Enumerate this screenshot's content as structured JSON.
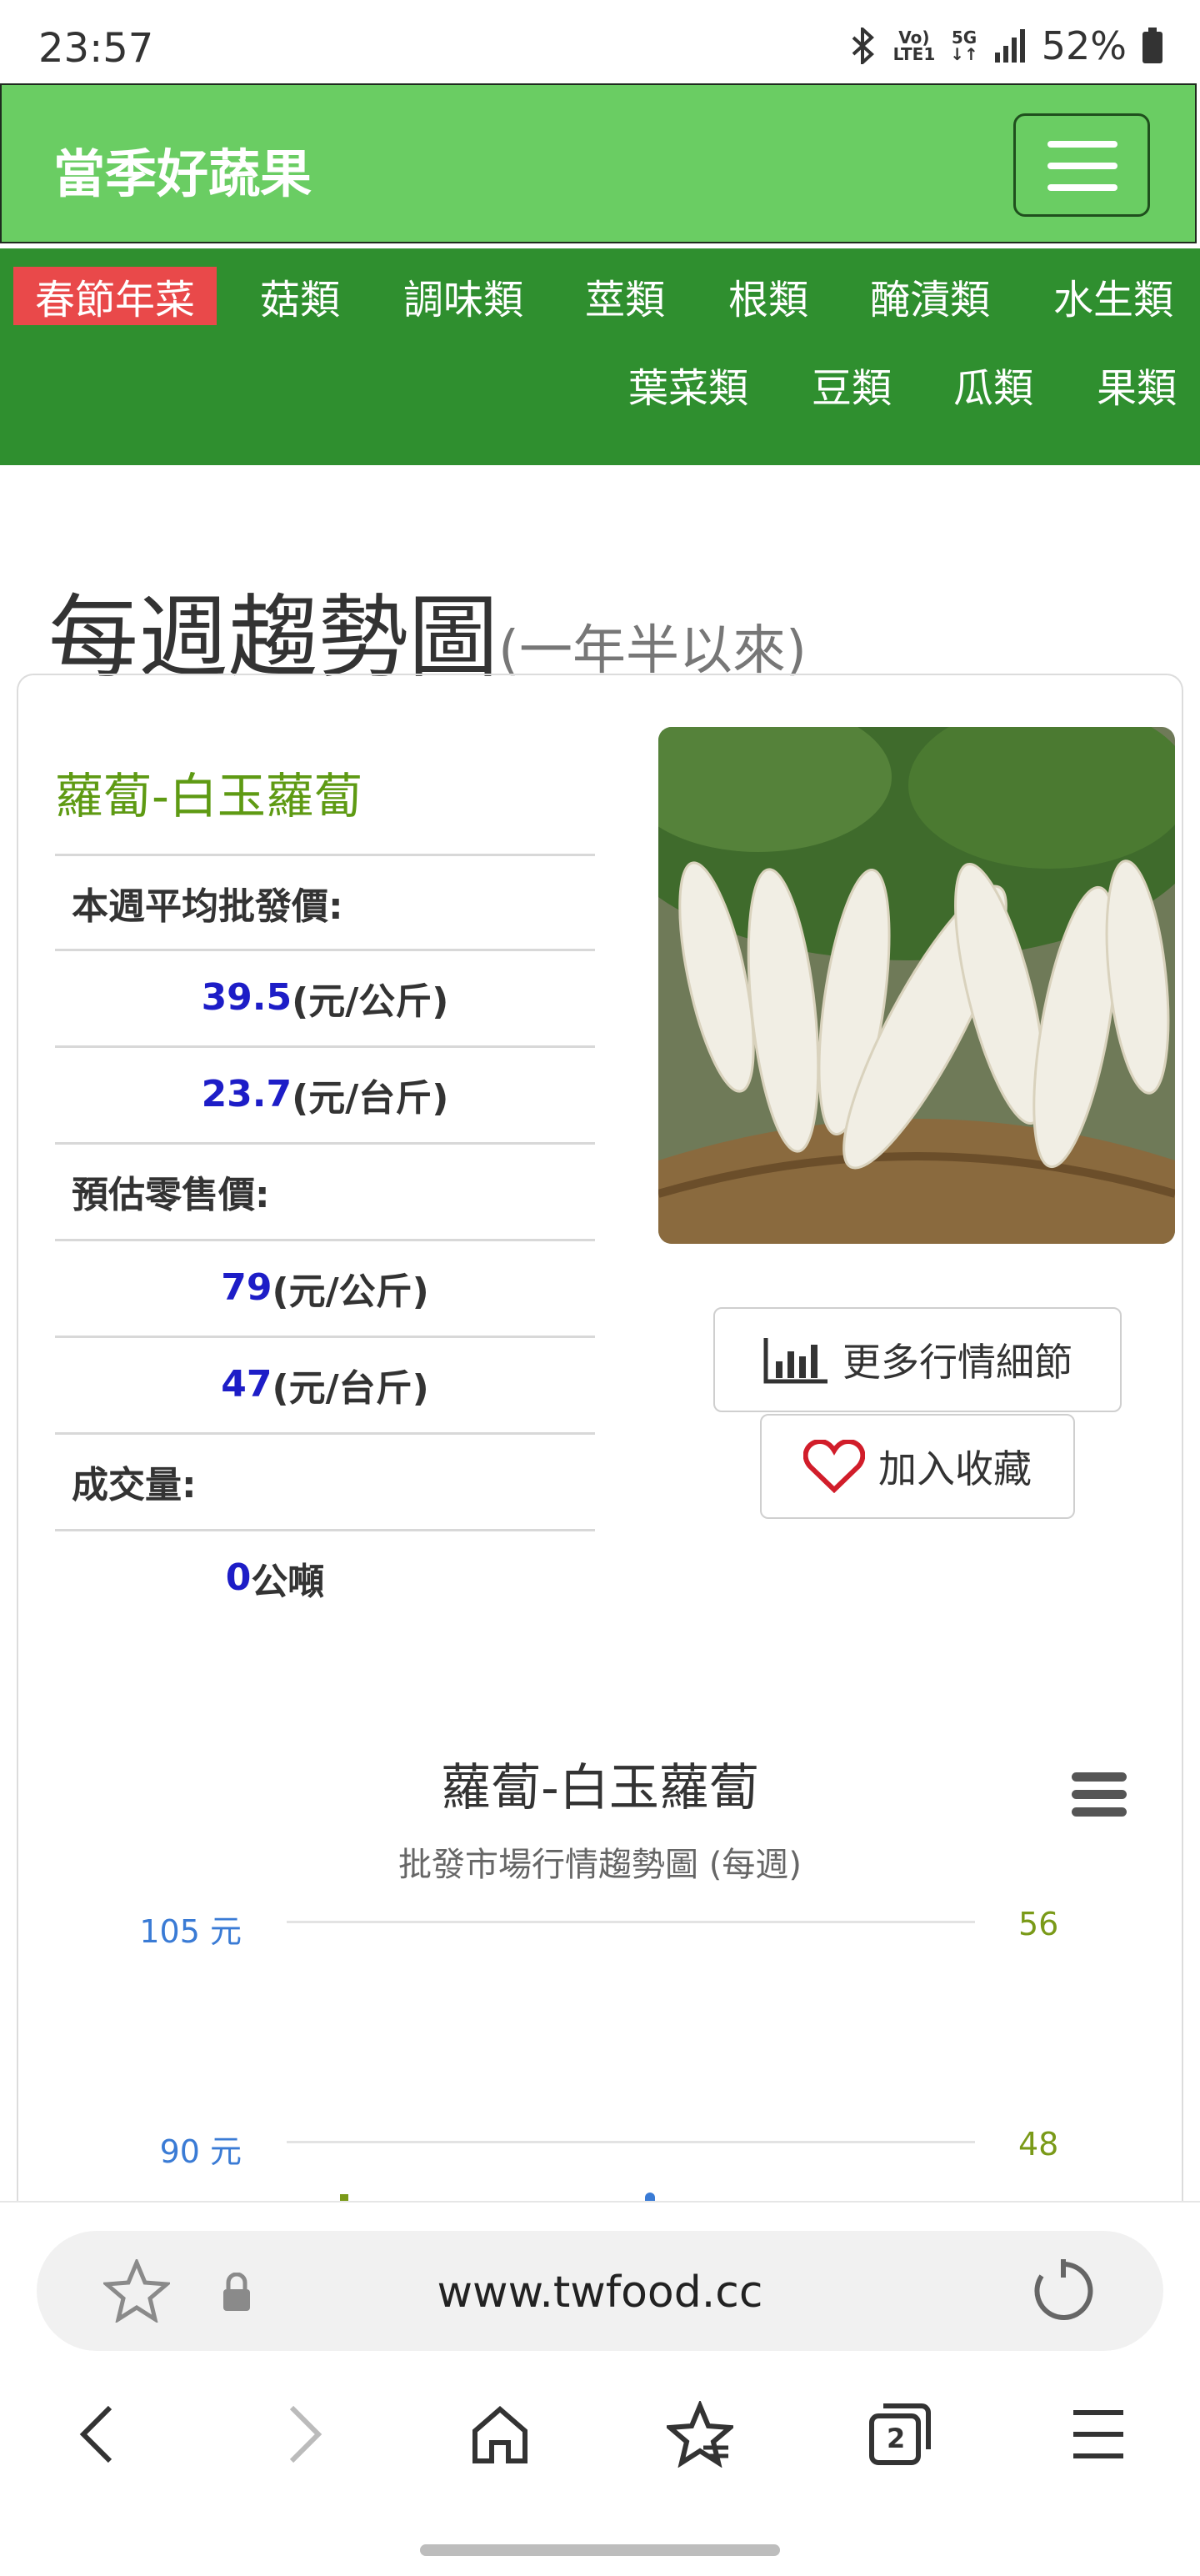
{
  "status_bar": {
    "time": "23:57",
    "net1": "Vo)",
    "net2": "LTE1",
    "net3": "5G",
    "battery": "52%"
  },
  "header": {
    "brand": "當季好蔬果"
  },
  "categories": [
    "春節年菜",
    "菇類",
    "調味類",
    "莖類",
    "根類",
    "醃漬類",
    "水生類",
    "葉菜類",
    "豆類",
    "瓜類",
    "果類"
  ],
  "section": {
    "title": "每週趨勢圖",
    "subtitle": "(一年半以來)"
  },
  "product": {
    "name": "蘿蔔-白玉蘿蔔",
    "wholesale_label": "本週平均批發價:",
    "wholesale_kg": "39.5",
    "wholesale_kg_unit": "(元/公斤)",
    "wholesale_tw": "23.7",
    "wholesale_tw_unit": "(元/台斤)",
    "retail_label": "預估零售價:",
    "retail_kg": "79",
    "retail_kg_unit": "(元/公斤)",
    "retail_tw": "47",
    "retail_tw_unit": "(元/台斤)",
    "volume_label": "成交量:",
    "volume": "0",
    "volume_unit": "公噸",
    "more_btn": "更多行情細節",
    "fav_btn": "加入收藏"
  },
  "chart": {
    "title": "蘿蔔-白玉蘿蔔",
    "subtitle": "批發市場行情趨勢圖 (每週)",
    "left_axis": [
      "105 元",
      "90 元"
    ],
    "right_axis": [
      "56",
      "48"
    ],
    "left_color": "#3a7bd5",
    "right_color": "#7a9a18"
  },
  "browser": {
    "url": "www.twfood.cc",
    "tabs_count": "2"
  }
}
